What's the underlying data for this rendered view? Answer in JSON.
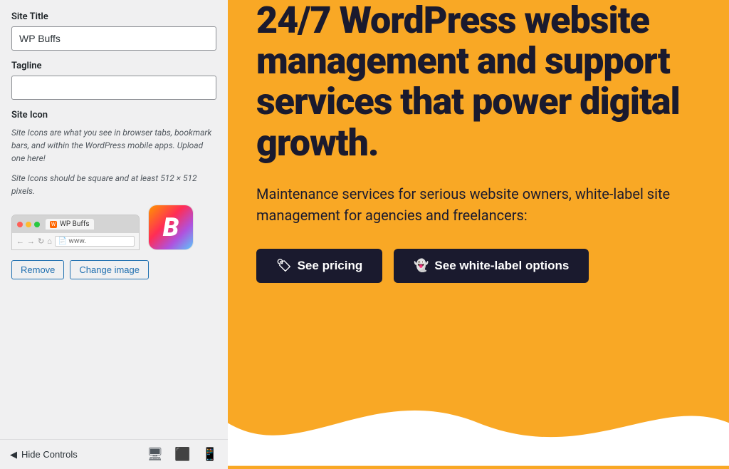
{
  "left_panel": {
    "site_title_label": "Site Title",
    "site_title_value": "WP Buffs",
    "tagline_label": "Tagline",
    "tagline_value": "",
    "tagline_placeholder": "",
    "site_icon_label": "Site Icon",
    "site_icon_desc1": "Site Icons are what you see in browser tabs, bookmark bars, and within the WordPress mobile apps. Upload one here!",
    "site_icon_desc2": "Site Icons should be square and at least 512 × 512 pixels.",
    "browser_tab_title": "WP Buffs",
    "address_bar_text": "www.",
    "remove_btn": "Remove",
    "change_image_btn": "Change image",
    "hide_controls_btn": "Hide Controls"
  },
  "right_panel": {
    "hero_title": "24/7 WordPress website management and support services that power digital growth.",
    "hero_subtitle": "Maintenance services for serious website owners, white-label site management for agencies and freelancers:",
    "cta_primary": "See pricing",
    "cta_secondary": "See white-label options",
    "pricing_icon": "🏷",
    "label_icon": "👻"
  },
  "colors": {
    "accent_yellow": "#f9a825",
    "dark_navy": "#1a1a2e"
  }
}
